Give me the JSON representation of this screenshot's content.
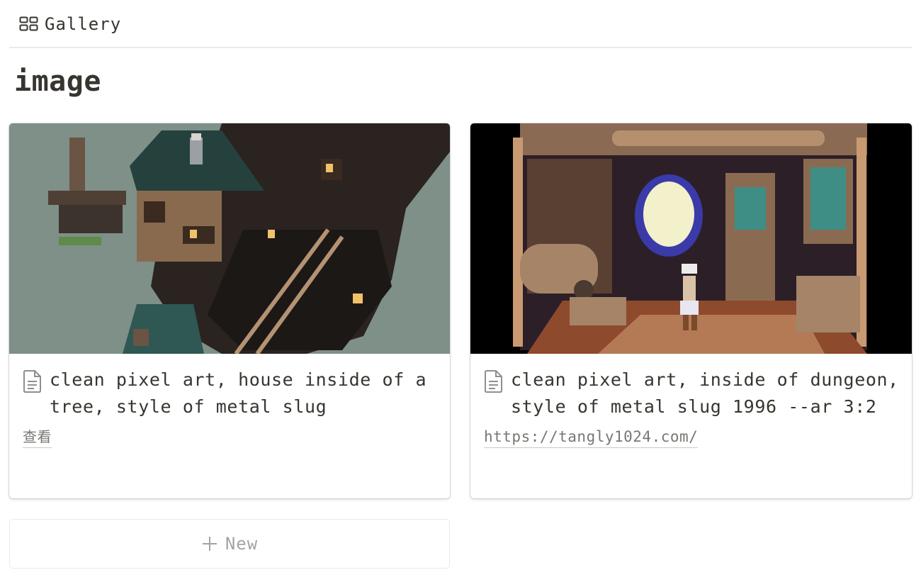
{
  "view": {
    "label": "Gallery",
    "icon": "gallery-grid-icon"
  },
  "page": {
    "title": "image"
  },
  "cards": [
    {
      "title": "clean pixel art, house inside of a tree, style of metal slug",
      "property": "查看",
      "icon": "document-icon"
    },
    {
      "title": "clean pixel art, inside of dungeon, style of metal slug 1996 --ar 3:2",
      "property": "https://tangly1024.com/",
      "icon": "document-icon"
    }
  ],
  "new_button": {
    "label": "New",
    "icon": "plus-icon"
  },
  "colors": {
    "text": "#37352f",
    "muted": "#787774",
    "border": "#e9e9e7",
    "placeholder": "#a5a4a0"
  }
}
